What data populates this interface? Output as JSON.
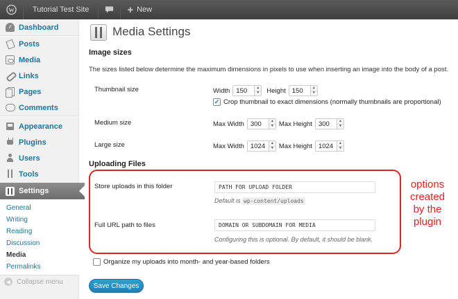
{
  "adminbar": {
    "site_name": "Tutorial Test Site",
    "new_label": "New"
  },
  "sidebar": {
    "items": [
      {
        "label": "Dashboard",
        "icon": "dashboard-icon"
      },
      {
        "label": "Posts",
        "icon": "posts-icon"
      },
      {
        "label": "Media",
        "icon": "media-icon"
      },
      {
        "label": "Links",
        "icon": "links-icon"
      },
      {
        "label": "Pages",
        "icon": "pages-icon"
      },
      {
        "label": "Comments",
        "icon": "comments-icon"
      },
      {
        "label": "Appearance",
        "icon": "appearance-icon"
      },
      {
        "label": "Plugins",
        "icon": "plugins-icon"
      },
      {
        "label": "Users",
        "icon": "users-icon"
      },
      {
        "label": "Tools",
        "icon": "tools-icon"
      },
      {
        "label": "Settings",
        "icon": "settings-icon"
      }
    ],
    "submenu": [
      "General",
      "Writing",
      "Reading",
      "Discussion",
      "Media",
      "Permalinks"
    ],
    "collapse_label": "Collapse menu"
  },
  "page": {
    "title": "Media Settings",
    "image_sizes_heading": "Image sizes",
    "image_sizes_desc": "The sizes listed below determine the maximum dimensions in pixels to use when inserting an image into the body of a post.",
    "thumbnail": {
      "label": "Thumbnail size",
      "width_label": "Width",
      "width": "150",
      "height_label": "Height",
      "height": "150",
      "crop_label": "Crop thumbnail to exact dimensions (normally thumbnails are proportional)",
      "crop_checked": true
    },
    "medium": {
      "label": "Medium size",
      "max_width_label": "Max Width",
      "max_width": "300",
      "max_height_label": "Max Height",
      "max_height": "300"
    },
    "large": {
      "label": "Large size",
      "max_width_label": "Max Width",
      "max_width": "1024",
      "max_height_label": "Max Height",
      "max_height": "1024"
    },
    "uploading_heading": "Uploading Files",
    "store_uploads": {
      "label": "Store uploads in this folder",
      "value": "PATH FOR UPLOAD FOLDER",
      "help_prefix": "Default is",
      "help_code": "wp-content/uploads"
    },
    "full_url": {
      "label": "Full URL path to files",
      "value": "DOMAIN OR SUBDOMAIN FOR MEDIA",
      "help": "Configuring this is optional. By default, it should be blank."
    },
    "organize_label": "Organize my uploads into month- and year-based folders",
    "organize_checked": false,
    "annotation": "options created by the plugin",
    "save_label": "Save Changes"
  },
  "colors": {
    "link": "#21759b",
    "annotation_red": "#e32222",
    "primary_button": "#2180b4"
  }
}
